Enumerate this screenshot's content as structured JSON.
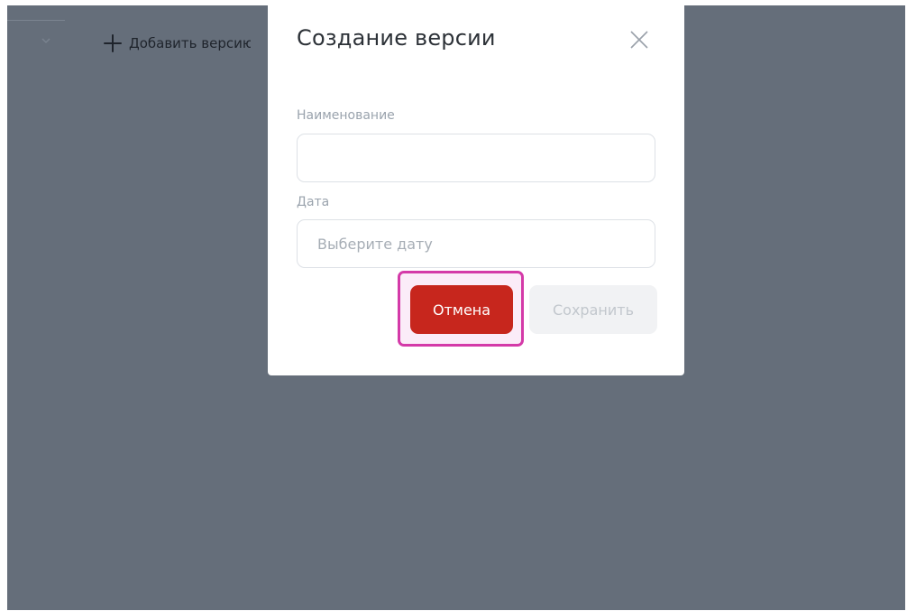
{
  "background": {
    "add_version_label": "Добавить версию"
  },
  "modal": {
    "title": "Создание версии",
    "close_icon": "close-icon",
    "fields": {
      "name": {
        "label": "Наименование",
        "value": "",
        "placeholder": ""
      },
      "date": {
        "label": "Дата",
        "value": "",
        "placeholder": "Выберите дату"
      }
    },
    "buttons": {
      "cancel_label": "Отмена",
      "save_label": "Сохранить"
    }
  },
  "colors": {
    "overlay": "#656e7a",
    "cancel_button": "#c7261d",
    "save_button_disabled": "#f1f2f4",
    "highlight": "#d43aa8"
  }
}
